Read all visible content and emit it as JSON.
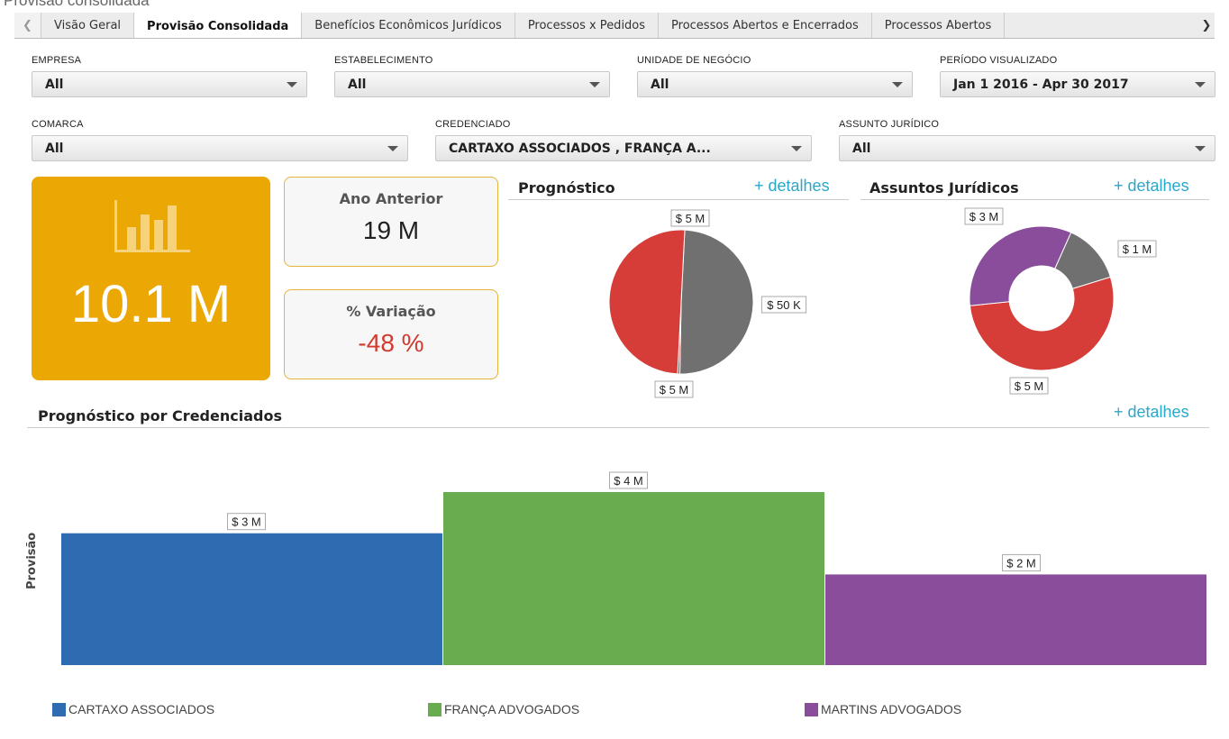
{
  "page": {
    "title": "Provisão consolidada"
  },
  "tabs": [
    {
      "label": "Visão Geral"
    },
    {
      "label": "Provisão Consolidada"
    },
    {
      "label": "Benefícios Econômicos Jurídicos"
    },
    {
      "label": "Processos x Pedidos"
    },
    {
      "label": "Processos Abertos e Encerrados"
    },
    {
      "label": "Processos Abertos"
    }
  ],
  "filters": {
    "empresa": {
      "label": "EMPRESA",
      "value": "All"
    },
    "estabelecimento": {
      "label": "ESTABELECIMENTO",
      "value": "All"
    },
    "unidade": {
      "label": "UNIDADE DE NEGÓCIO",
      "value": "All"
    },
    "periodo": {
      "label": "PERÍODO VISUALIZADO",
      "value": "Jan 1 2016 - Apr 30 2017"
    },
    "comarca": {
      "label": "COMARCA",
      "value": "All"
    },
    "credenciado": {
      "label": "CREDENCIADO",
      "value": "CARTAXO ASSOCIADOS , FRANÇA A..."
    },
    "assunto": {
      "label": "ASSUNTO JURÍDICO",
      "value": "All"
    }
  },
  "kpis": {
    "total": "10.1 M",
    "ano_anterior": {
      "label": "Ano Anterior",
      "value": "19 M"
    },
    "variacao": {
      "label": "% Variação",
      "value": "-48 %"
    }
  },
  "sections": {
    "prognostico": {
      "title": "Prognóstico",
      "link": "+ detalhes"
    },
    "assuntos": {
      "title": "Assuntos Jurídicos",
      "link": "+ detalhes"
    },
    "credenciados": {
      "title": "Prognóstico por Credenciados",
      "link": "+ detalhes"
    }
  },
  "colors": {
    "accent": "#eba804",
    "gray": "#707070",
    "red": "#d63c38",
    "purple": "#894d9c",
    "blue": "#2e6bb0",
    "green": "#69ab4f",
    "link": "#2aa7c9"
  },
  "chart_data": [
    {
      "type": "pie",
      "title": "Prognóstico",
      "slices": [
        {
          "value": 5,
          "label": "$ 5 M",
          "color": "#707070"
        },
        {
          "value": 0.05,
          "label": "$ 50 K",
          "color": "#d63c38"
        },
        {
          "value": 5.05,
          "label": "$ 5 M",
          "color": "#d63c38"
        }
      ]
    },
    {
      "type": "pie",
      "title": "Assuntos Jurídicos",
      "donut": true,
      "slices": [
        {
          "value": 1.3,
          "label": "$ 1 M",
          "color": "#707070"
        },
        {
          "value": 5.1,
          "label": "$ 5 M",
          "color": "#d63c38"
        },
        {
          "value": 3.2,
          "label": "$ 3 M",
          "color": "#894d9c"
        }
      ]
    },
    {
      "type": "bar",
      "title": "Prognóstico por Credenciados",
      "ylabel": "Provisão",
      "categories": [
        "CARTAXO ASSOCIADOS",
        "FRANÇA ADVOGADOS",
        "MARTINS ADVOGADOS"
      ],
      "values": [
        3.2,
        4.2,
        2.2
      ],
      "value_labels": [
        "$ 3 M",
        "$ 4 M",
        "$ 2 M"
      ],
      "colors": [
        "#2e6bb0",
        "#69ab4f",
        "#894d9c"
      ],
      "ylim": [
        0,
        4.2
      ]
    }
  ]
}
